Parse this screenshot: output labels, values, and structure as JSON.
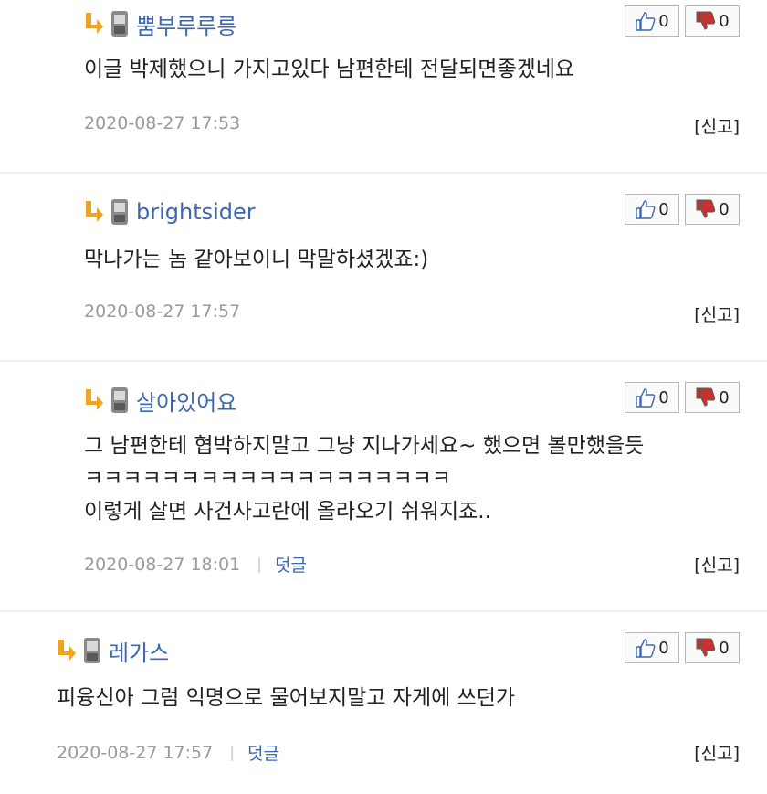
{
  "comments": [
    {
      "author": "뿜부루루릉",
      "likes": "0",
      "dislikes": "0",
      "text": "이글 박제했으니 가지고있다 남편한테 전달되면좋겠네요",
      "date": "2020-08-27 17:53",
      "reply_label": "",
      "report_label": "[신고]"
    },
    {
      "author": "brightsider",
      "likes": "0",
      "dislikes": "0",
      "text": "막나가는 놈 같아보이니 막말하셨겠죠:)",
      "date": "2020-08-27 17:57",
      "reply_label": "",
      "report_label": "[신고]"
    },
    {
      "author": "살아있어요",
      "likes": "0",
      "dislikes": "0",
      "text": "그 남편한테 협박하지말고 그냥 지나가세요~ 했으면 볼만했을듯\nㅋㅋㅋㅋㅋㅋㅋㅋㅋㅋㅋㅋㅋㅋㅋㅋㅋㅋㅋ\n이렇게 살면 사건사고란에 올라오기 쉬워지죠..",
      "date": "2020-08-27 18:01",
      "reply_label": "덧글",
      "report_label": "[신고]"
    },
    {
      "author": "레가스",
      "likes": "0",
      "dislikes": "0",
      "text": "피융신아 그럼 익명으로 물어보지말고 자게에 쓰던가",
      "date": "2020-08-27 17:57",
      "reply_label": "덧글",
      "report_label": "[신고]"
    }
  ],
  "icons": {
    "reply_arrow": "reply-arrow-icon",
    "mobile": "mobile-phone-icon",
    "like": "thumbs-up-icon",
    "dislike": "thumbs-down-icon"
  },
  "colors": {
    "author": "#3e67b1",
    "arrow": "#f0a31f",
    "meta": "#9a9a9a",
    "divider": "#eeeeee"
  }
}
